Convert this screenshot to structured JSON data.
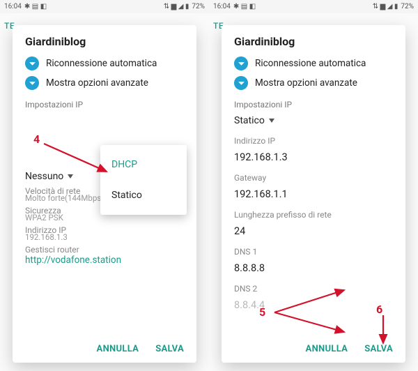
{
  "statusbar": {
    "time": "16:04",
    "battery": "72%",
    "icons_left": "✱ ▤ ◧",
    "icons_right": "⇅ ▆ ◢ ▮"
  },
  "tab_hint": "TE",
  "dialog_title": "Giardiniblog",
  "rows": {
    "auto_reconnect": "Riconnessione automatica",
    "advanced_opts": "Mostra opzioni avanzate"
  },
  "ip_settings_label": "Impostazioni IP",
  "spinner_static": "Statico",
  "dropdown": {
    "dhcp": "DHCP",
    "static": "Statico"
  },
  "below_dd_value": "Nessuno",
  "left_info": {
    "speed_label": "Velocità di rete",
    "speed_value": "Molto forte(144Mbps)",
    "security_label": "Sicurezza",
    "security_value": "WPA2 PSK",
    "ip_label": "Indirizzo IP",
    "ip_value": "192.168.1.3",
    "router_label": "Gestisci router",
    "router_link": "http://vodafone.station"
  },
  "right_fields": {
    "ip_label": "Indirizzo IP",
    "ip_value": "192.168.1.3",
    "gw_label": "Gateway",
    "gw_value": "192.168.1.1",
    "plen_label": "Lunghezza prefisso di rete",
    "plen_value": "24",
    "dns1_label": "DNS 1",
    "dns1_value": "8.8.8.8",
    "dns2_label": "DNS 2",
    "dns2_value": "8.8.4.4"
  },
  "actions": {
    "cancel": "ANNULLA",
    "save": "SALVA"
  },
  "ann": {
    "n4": "4",
    "n5": "5",
    "n6": "6"
  }
}
